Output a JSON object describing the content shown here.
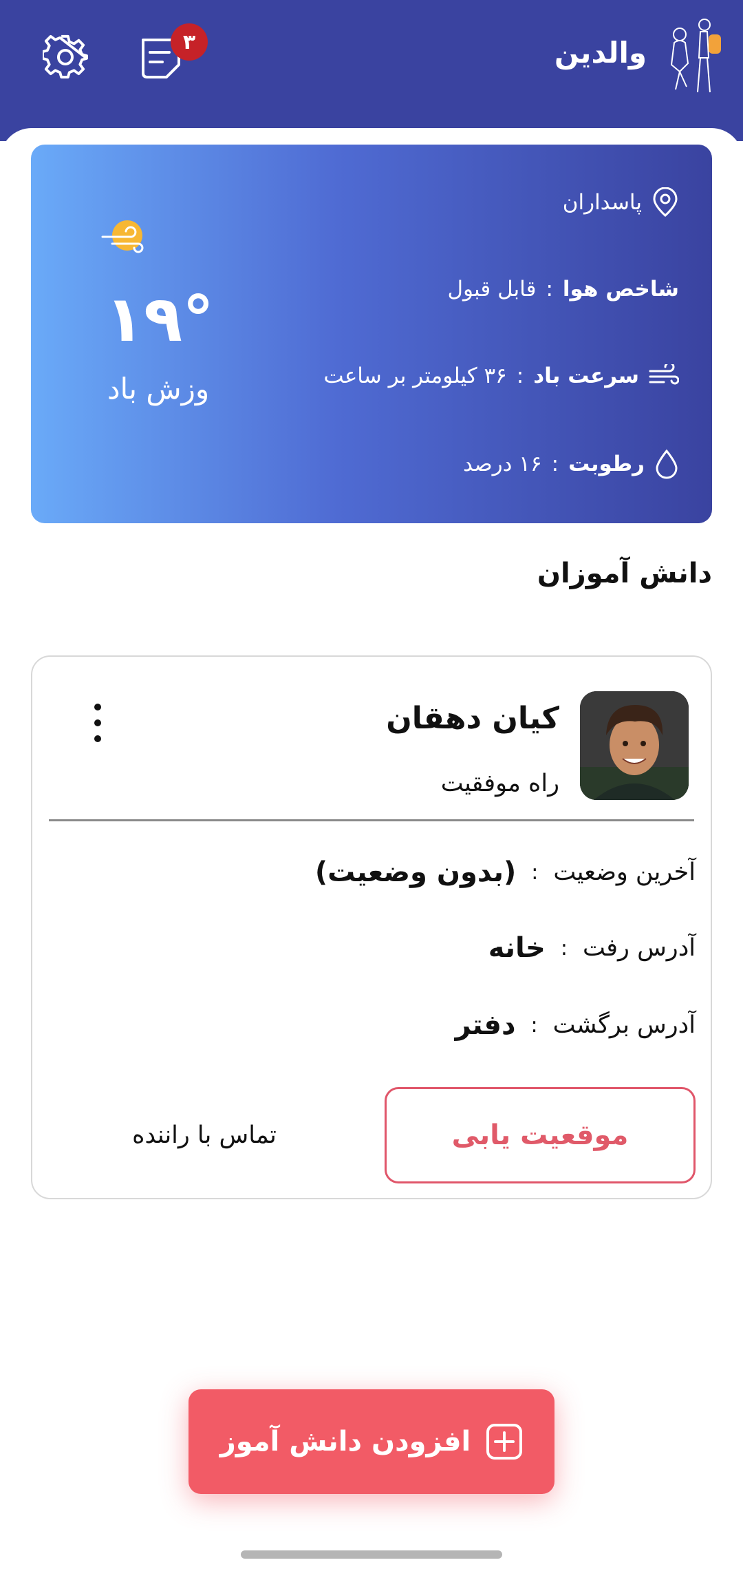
{
  "header": {
    "title": "والدین",
    "notification_count": "۳",
    "colors": {
      "background": "#3a43a0",
      "badge": "#c62228"
    }
  },
  "weather": {
    "location": "پاسداران",
    "air_quality_label": "شاخص هوا",
    "air_quality_value": "قابل قبول",
    "wind_speed_label": "سرعت باد",
    "wind_speed_value": "۳۶ کیلومتر بر ساعت",
    "humidity_label": "رطوبت",
    "humidity_value": "۱۶ درصد",
    "temperature": "۱۹°",
    "condition": "وزش باد",
    "separator": ":"
  },
  "students_section": {
    "title": "دانش آموزان"
  },
  "student": {
    "name": "کیان دهقان",
    "route": "راه موفقیت",
    "last_status_label": "آخرین وضعیت",
    "last_status_value": "(بدون وضعیت)",
    "pickup_address_label": "آدرس رفت",
    "pickup_address_value": "خانه",
    "return_address_label": "آدرس برگشت",
    "return_address_value": "دفتر",
    "locate_button": "موقعیت یابی",
    "call_driver_button": "تماس با راننده"
  },
  "fab": {
    "label": "افزودن دانش آموز",
    "color": "#f25b66"
  }
}
